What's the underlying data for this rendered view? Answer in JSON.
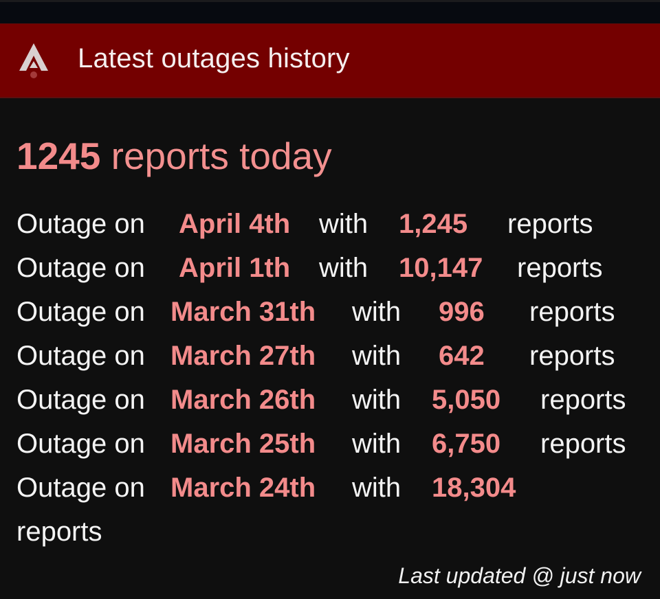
{
  "header": {
    "title": "Latest outages history",
    "logo_icon": "apex-legends-logo-icon"
  },
  "summary": {
    "count": "1245",
    "label": "reports today"
  },
  "outages": [
    {
      "prefix": "Outage on",
      "date": "April 4th",
      "with": "with",
      "count": "1,245",
      "suffix": "reports"
    },
    {
      "prefix": "Outage on",
      "date": "April 1th",
      "with": "with",
      "count": "10,147",
      "suffix": "reports"
    },
    {
      "prefix": "Outage on",
      "date": "March 31th",
      "with": "with",
      "count": "996",
      "suffix": "reports"
    },
    {
      "prefix": "Outage on",
      "date": "March 27th",
      "with": "with",
      "count": "642",
      "suffix": "reports"
    },
    {
      "prefix": "Outage on",
      "date": "March 26th",
      "with": "with",
      "count": "5,050",
      "suffix": "reports"
    },
    {
      "prefix": "Outage on",
      "date": "March 25th",
      "with": "with",
      "count": "6,750",
      "suffix": "reports"
    },
    {
      "prefix": "Outage on",
      "date": "March 24th",
      "with": "with",
      "count": "18,304",
      "suffix": "reports"
    }
  ],
  "footer": {
    "last_updated": "Last updated @ just now"
  },
  "colors": {
    "header_bg": "#740000",
    "page_bg": "#0f0f0f",
    "accent": "#f38b8b",
    "text": "#f4f4f4"
  }
}
